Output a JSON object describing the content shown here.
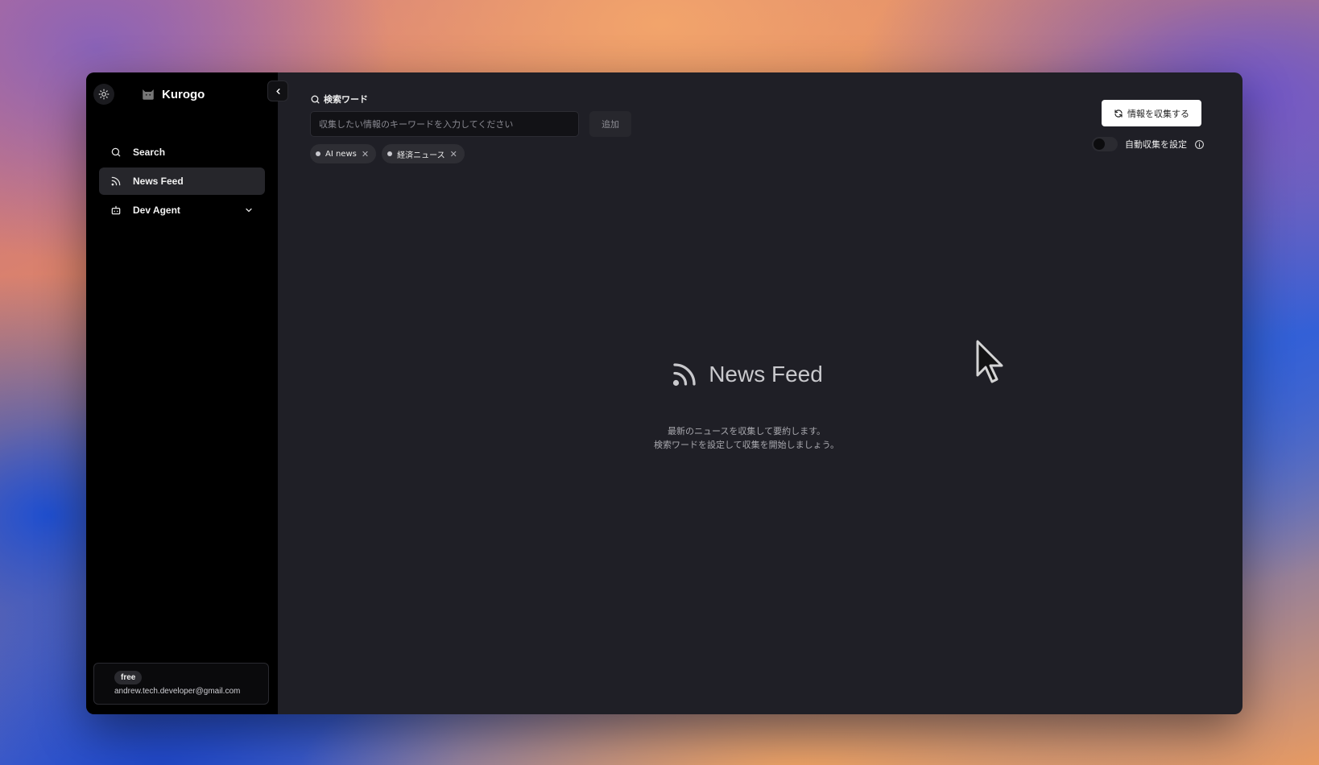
{
  "app": {
    "name": "Kurogo"
  },
  "sidebar": {
    "items": [
      {
        "label": "Search",
        "icon": "search-icon"
      },
      {
        "label": "News Feed",
        "icon": "rss-icon",
        "active": true
      },
      {
        "label": "Dev Agent",
        "icon": "bot-icon",
        "expandable": true
      }
    ],
    "account": {
      "plan": "free",
      "email": "andrew.tech.developer@gmail.com"
    }
  },
  "search": {
    "label": "検索ワード",
    "placeholder": "収集したい情報のキーワードを入力してください",
    "add_label": "追加",
    "tags": [
      "AI news",
      "経済ニュース"
    ]
  },
  "actions": {
    "collect_label": "情報を収集する",
    "auto_collect_label": "自動収集を設定",
    "auto_collect_enabled": false
  },
  "empty_state": {
    "title": "News Feed",
    "line1": "最新のニュースを収集して要約します。",
    "line2": "検索ワードを設定して収集を開始しましょう。"
  },
  "colors": {
    "sidebar_bg": "#000000",
    "main_bg": "#1f1f26",
    "accent_text": "#ffffff"
  }
}
